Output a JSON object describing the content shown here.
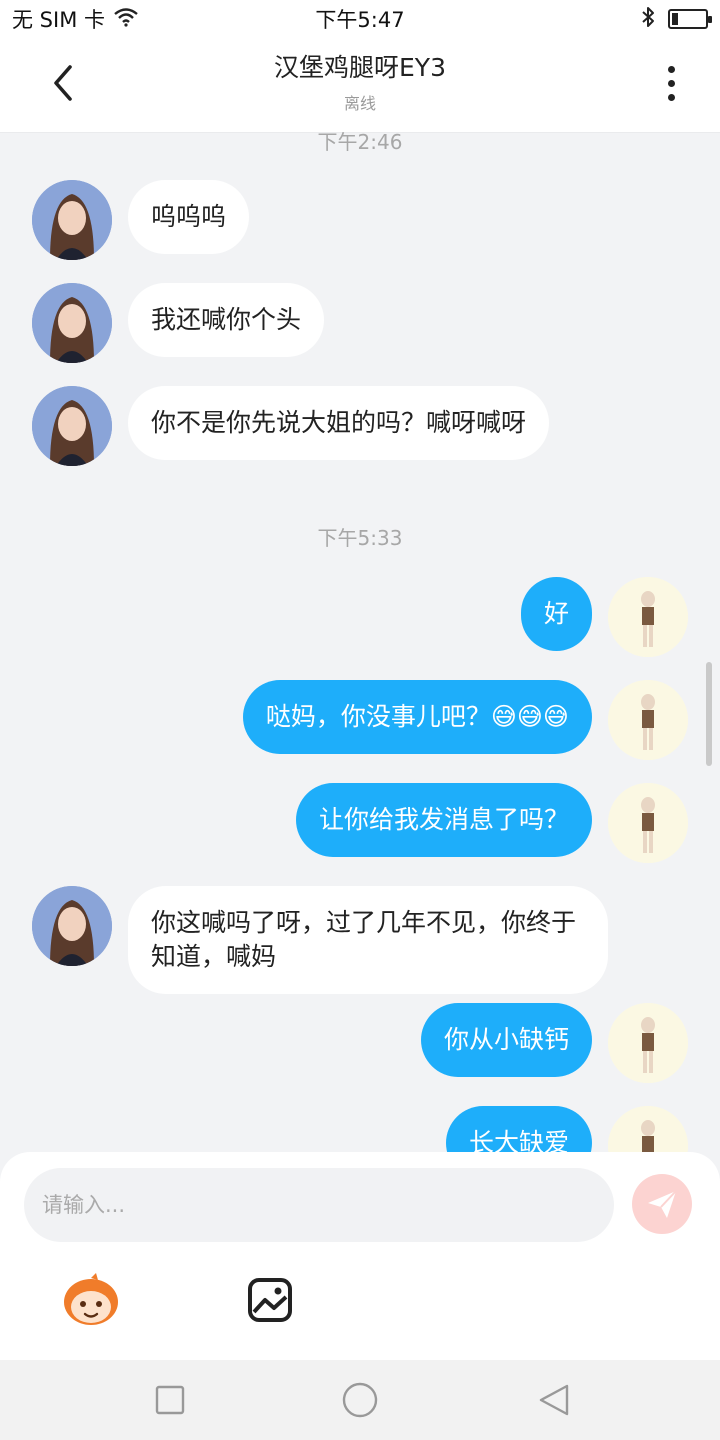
{
  "status_bar": {
    "carrier": "无 SIM 卡",
    "time": "下午5:47",
    "battery_level": 0.2,
    "icons": [
      "wifi-icon",
      "bluetooth-icon",
      "battery-icon"
    ]
  },
  "header": {
    "title": "汉堡鸡腿呀EY3",
    "status": "离线",
    "icons": [
      "back-icon",
      "more-icon"
    ]
  },
  "chat": {
    "time_labels": [
      "下午2:46",
      "下午5:33"
    ],
    "messages": [
      {
        "side": "left",
        "text": "呜呜呜"
      },
      {
        "side": "left",
        "text": "我还喊你个头"
      },
      {
        "side": "left",
        "text": "你不是你先说大姐的吗？喊呀喊呀"
      },
      {
        "side": "right",
        "text": "好"
      },
      {
        "side": "right",
        "text": "哒妈，你没事儿吧？😅😅😅"
      },
      {
        "side": "right",
        "text": "让你给我发消息了吗？"
      },
      {
        "side": "left",
        "text": "你这喊吗了呀，过了几年不见，你终于知道，喊妈"
      },
      {
        "side": "right",
        "text": "你从小缺钙"
      },
      {
        "side": "right",
        "text": "长大缺爱"
      }
    ]
  },
  "input": {
    "placeholder": "请输入...",
    "value": ""
  },
  "colors": {
    "accent": "#1eaefa",
    "send_button": "#fcd3d1",
    "background": "#f2f3f5"
  },
  "nav_bar": {
    "icons": [
      "recent-apps-icon",
      "home-icon",
      "back-nav-icon"
    ]
  }
}
